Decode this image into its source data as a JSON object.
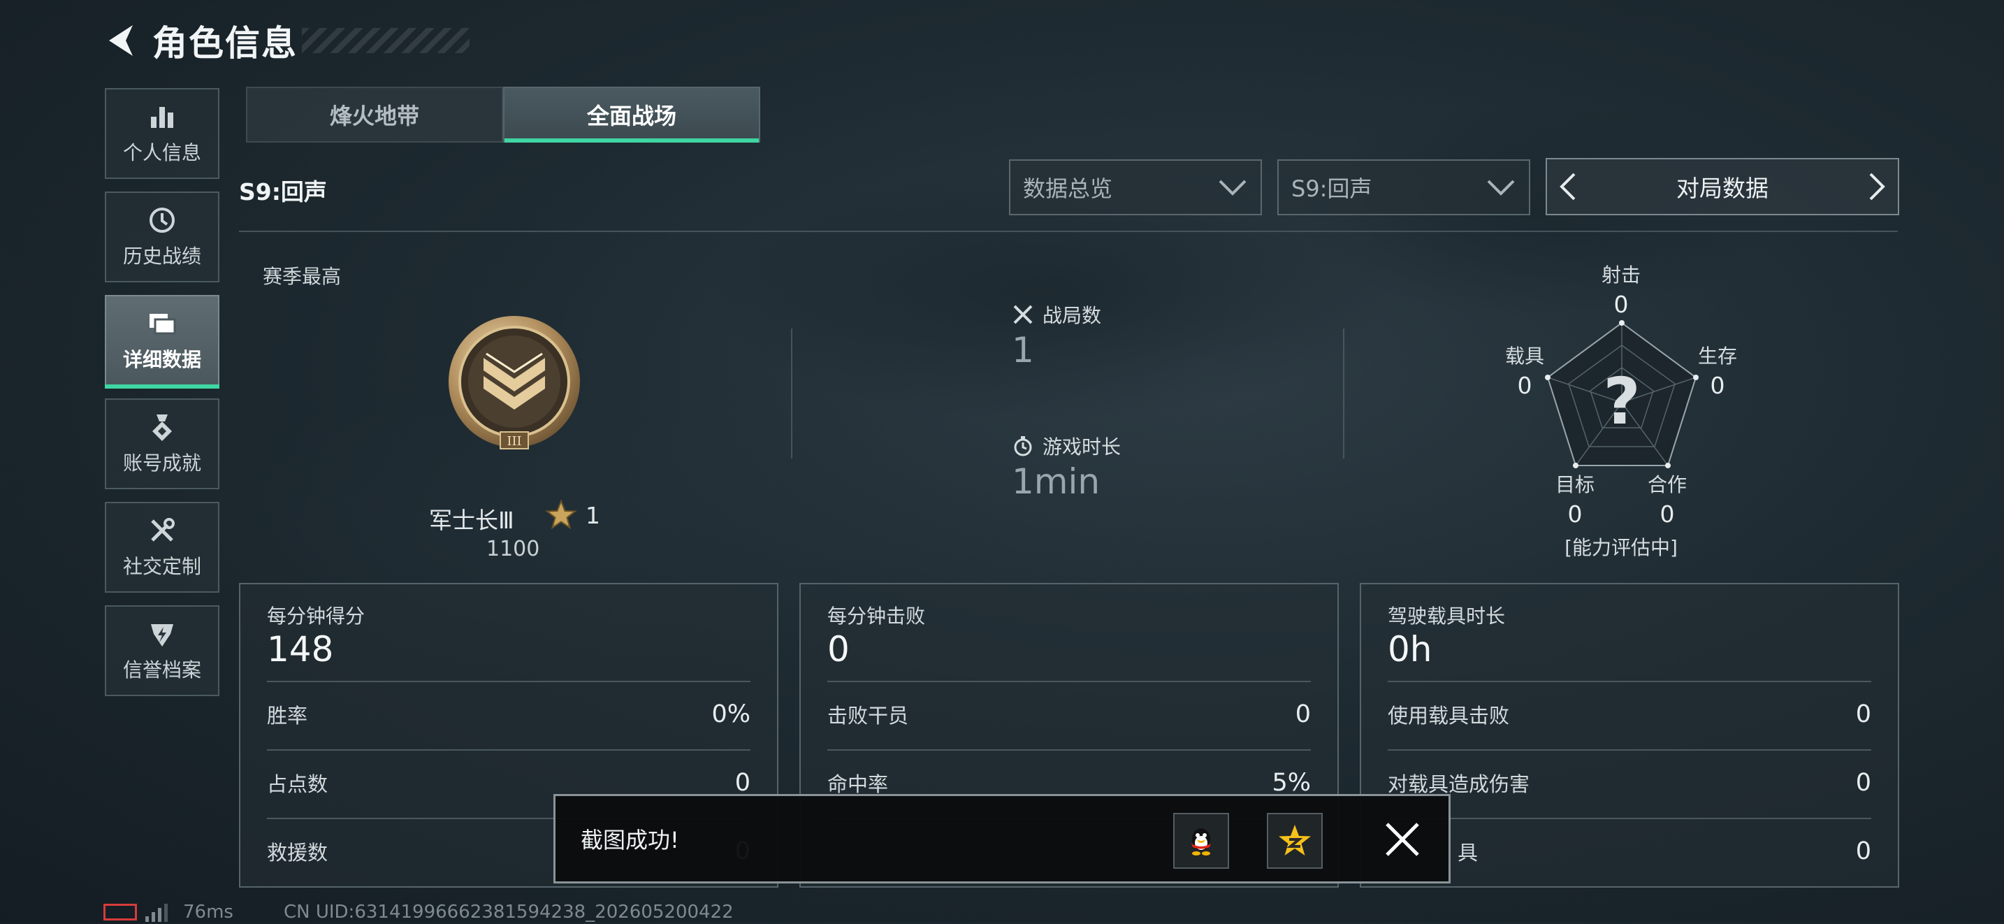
{
  "header": {
    "title": "角色信息",
    "back_icon": "back-arrow-icon"
  },
  "sidebar": {
    "items": [
      {
        "label": "个人信息",
        "icon": "bar-chart-icon",
        "active": false
      },
      {
        "label": "历史战绩",
        "icon": "history-clock-icon",
        "active": false
      },
      {
        "label": "详细数据",
        "icon": "folders-icon",
        "active": true
      },
      {
        "label": "账号成就",
        "icon": "medal-icon",
        "active": false
      },
      {
        "label": "社交定制",
        "icon": "tools-icon",
        "active": false
      },
      {
        "label": "信誉档案",
        "icon": "shield-bolt-icon",
        "active": false
      }
    ]
  },
  "mode_tabs": [
    {
      "label": "烽火地带",
      "active": false
    },
    {
      "label": "全面战场",
      "active": true
    }
  ],
  "toolbar": {
    "season_title": "S9:回声",
    "dropdown_view": "数据总览",
    "dropdown_season": "S9:回声",
    "pager_label": "对局数据"
  },
  "summary": {
    "best_label": "赛季最高",
    "rank_name": "军士长Ⅲ",
    "rank_stars": "1",
    "rank_score": "1100",
    "matches_label": "战局数",
    "matches_value": "1",
    "playtime_label": "游戏时长",
    "playtime_value": "1min"
  },
  "radar": {
    "center_glyph": "?",
    "status": "[能力评估中]",
    "axes": [
      {
        "label": "射击",
        "value": "0"
      },
      {
        "label": "生存",
        "value": "0"
      },
      {
        "label": "合作",
        "value": "0"
      },
      {
        "label": "目标",
        "value": "0"
      },
      {
        "label": "载具",
        "value": "0"
      }
    ]
  },
  "panels": [
    {
      "header_label": "每分钟得分",
      "header_value": "148",
      "rows": [
        {
          "label": "胜率",
          "value": "0%"
        },
        {
          "label": "占点数",
          "value": "0"
        },
        {
          "label": "救援数",
          "value": "0"
        }
      ]
    },
    {
      "header_label": "每分钟击败",
      "header_value": "0",
      "rows": [
        {
          "label": "击败干员",
          "value": "0"
        },
        {
          "label": "命中率",
          "value": "5%"
        },
        {
          "label": "",
          "value": ""
        }
      ]
    },
    {
      "header_label": "驾驶载具时长",
      "header_value": "0h",
      "rows": [
        {
          "label": "使用载具击败",
          "value": "0"
        },
        {
          "label": "对载具造成伤害",
          "value": "0"
        },
        {
          "label": "具",
          "value": "0"
        }
      ]
    }
  ],
  "toast": {
    "message": "截图成功!",
    "share_qq_icon": "qq-penguin-icon",
    "share_qzone_icon": "qzone-star-icon",
    "close_icon": "close-x-icon"
  },
  "footer": {
    "ping": "76ms",
    "uid": "CN UID:6314199666238159423‌8_202605200422"
  },
  "colors": {
    "accent": "#3fd6a3",
    "battery_low": "#d63b3b"
  }
}
